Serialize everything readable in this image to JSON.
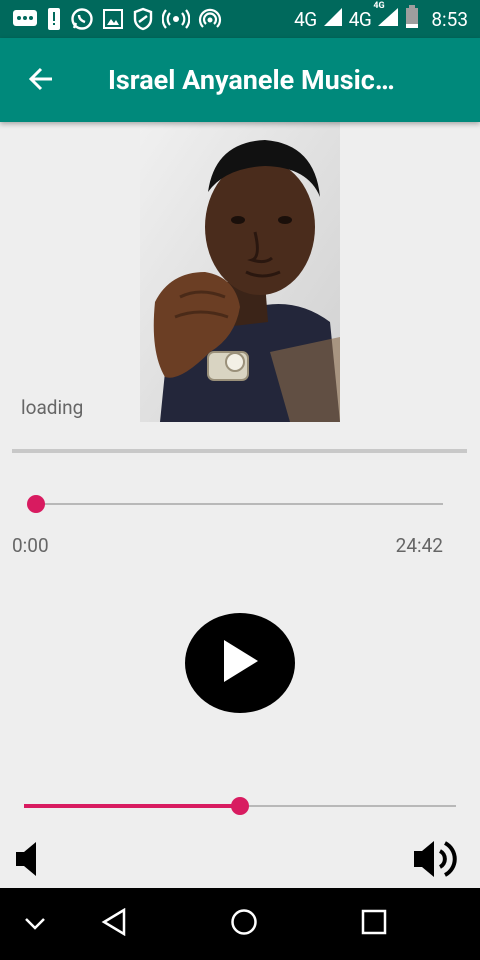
{
  "status_bar": {
    "network_1": "4G",
    "network_2": "4G",
    "network_2_badge": "4G",
    "time": "8:53",
    "icons": [
      "message-icon",
      "alert-icon",
      "whatsapp-icon",
      "image-icon",
      "vpn-icon",
      "broadcast-icon",
      "hotspot-icon",
      "signal-icon",
      "battery-icon"
    ]
  },
  "app_bar": {
    "title": "Israel Anyanele Music…",
    "back_icon": "arrow-back-icon"
  },
  "player": {
    "status_text": "loading",
    "current_time": "0:00",
    "total_time": "24:42",
    "seek_progress": 0.0,
    "volume_level": 0.5,
    "accent_color": "#d81b60",
    "play_icon": "play-icon"
  },
  "nav_bar": {
    "icons": [
      "chevron-down-icon",
      "back-triangle-icon",
      "home-circle-icon",
      "recents-square-icon"
    ]
  }
}
